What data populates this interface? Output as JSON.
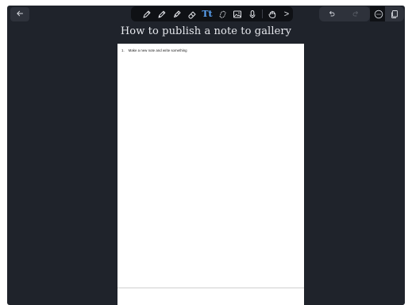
{
  "header": {
    "back_icon": "arrow-left-icon",
    "title": "How to publish a note to gallery"
  },
  "toolbar": {
    "tools": [
      {
        "name": "pen-tool",
        "icon": "pen-icon",
        "active": false
      },
      {
        "name": "pencil-tool",
        "icon": "pencil-icon",
        "active": false
      },
      {
        "name": "marker-tool",
        "icon": "marker-icon",
        "active": false
      },
      {
        "name": "eraser-tool",
        "icon": "eraser-icon",
        "active": false
      },
      {
        "name": "text-tool",
        "icon": "text-icon",
        "label": "Tt",
        "active": true
      },
      {
        "name": "lasso-tool",
        "icon": "lasso-icon",
        "active": false
      },
      {
        "name": "image-tool",
        "icon": "image-icon",
        "active": false
      },
      {
        "name": "audio-tool",
        "icon": "microphone-icon",
        "active": false
      },
      {
        "name": "stamp-tool",
        "icon": "hand-icon",
        "active": false
      },
      {
        "name": "expand-tool",
        "icon": "chevron-right-icon",
        "label": ">",
        "active": false
      }
    ],
    "accent_color": "#5ba4f6"
  },
  "actions": {
    "undo_icon": "undo-icon",
    "redo_icon": "redo-icon",
    "more_icon": "more-icon",
    "pages_icon": "pages-icon"
  },
  "document": {
    "list_items": [
      {
        "number": "1.",
        "text": "Make a new note and write something"
      }
    ]
  }
}
